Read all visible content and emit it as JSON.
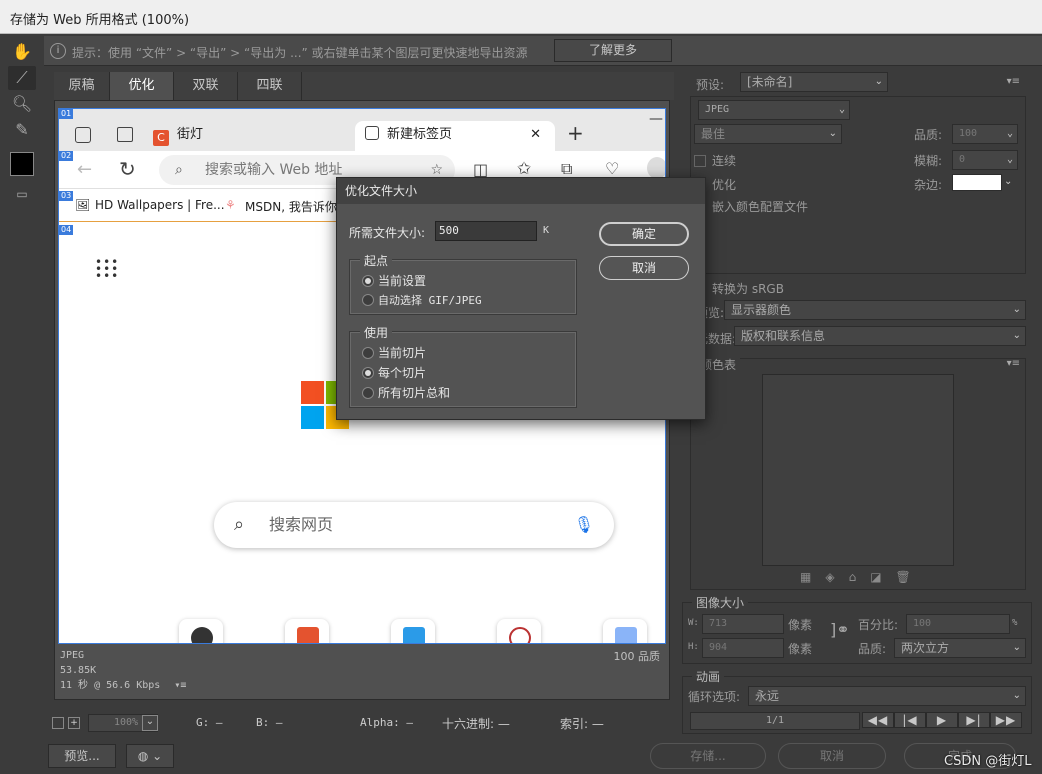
{
  "window": {
    "title": "存储为 Web 所用格式 (100%)"
  },
  "tip": {
    "text": "提示：使用 “文件” > “导出” > “导出为 ...” 或右键单击某个图层可更快速地导出资源",
    "learn_more": "了解更多"
  },
  "tabs": [
    "原稿",
    "优化",
    "双联",
    "四联"
  ],
  "active_tab": "优化",
  "slices": [
    "01",
    "02",
    "03",
    "04"
  ],
  "browser": {
    "tab1": "街灯L_MySQL,Photoshop,",
    "tab2": "新建标签页",
    "address_placeholder": "搜索或输入 Web 地址",
    "bookmark1": "HD Wallpapers | Fre...",
    "bookmark2": "MSDN, 我告诉你",
    "search_placeholder": "搜索网页"
  },
  "preview_status": {
    "format": "JPEG",
    "size": "53.85K",
    "time": "11 秒 @ 56.6 Kbps",
    "quality": "100 品质"
  },
  "right_panel": {
    "preset_label": "预设:",
    "preset_value": "[未命名]",
    "format": "JPEG",
    "quality_level": "最佳",
    "quality_label": "品质:",
    "quality_value": "100",
    "progressive": "连续",
    "blur_label": "模糊:",
    "blur_value": "0",
    "optimized": "优化",
    "matte_label": "杂边:",
    "embed_profile": "嵌入颜色配置文件",
    "convert_srgb": "转换为 sRGB",
    "preview_label": "预览:",
    "preview_value": "显示器颜色",
    "metadata_label": "元数据:",
    "metadata_value": "版权和联系信息",
    "color_table": "颜色表",
    "image_size": "图像大小",
    "w_label": "W:",
    "w_value": "713",
    "h_label": "H:",
    "h_value": "904",
    "px": "像素",
    "percent_label": "百分比:",
    "percent_value": "100",
    "percent_unit": "%",
    "resample_label": "品质:",
    "resample_value": "两次立方",
    "animation": "动画",
    "loop_label": "循环选项:",
    "loop_value": "永远",
    "frame": "1/1"
  },
  "dialog": {
    "title": "优化文件大小",
    "size_label": "所需文件大小:",
    "size_value": "500",
    "size_unit": "K",
    "ok": "确定",
    "cancel": "取消",
    "start_legend": "起点",
    "start_options": [
      "当前设置",
      "自动选择 GIF/JPEG"
    ],
    "start_selected": 0,
    "use_legend": "使用",
    "use_options": [
      "当前切片",
      "每个切片",
      "所有切片总和"
    ],
    "use_selected": 1
  },
  "bottom": {
    "zoom": "100%",
    "g": "G: —",
    "b": "B: —",
    "alpha": "Alpha: —",
    "hex": "十六进制: —",
    "index": "索引: —"
  },
  "footer": {
    "preview": "预览...",
    "save": "存储...",
    "cancel": "取消",
    "done": "完成",
    "watermark": "CSDN @街灯L"
  }
}
